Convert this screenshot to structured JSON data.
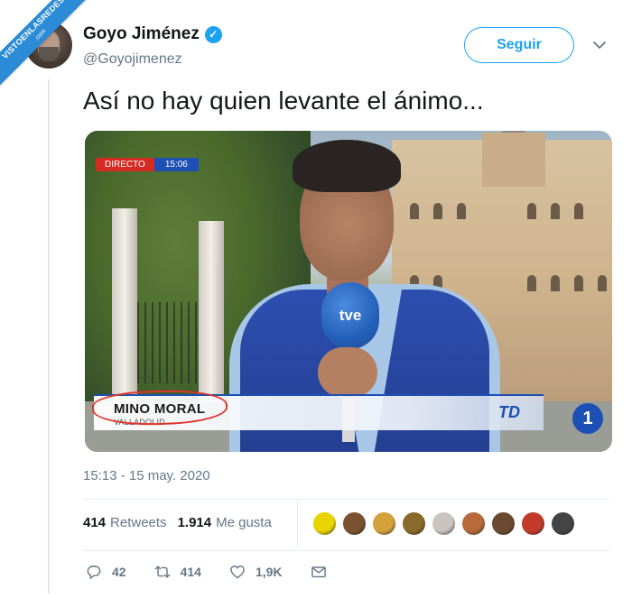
{
  "watermark": {
    "line1": "VISTOENLASREDES",
    "line2": ".com"
  },
  "author": {
    "display_name": "Goyo Jiménez",
    "handle": "@Goyojimenez",
    "verified_icon": "✓"
  },
  "follow_label": "Seguir",
  "tweet_text": "Así no hay quien levante el ánimo...",
  "media": {
    "live_label": "DIRECTO",
    "clock": "15:06",
    "mic_logo": "tve",
    "caption_name": "MINO MORAL",
    "caption_place": "VALLADOLID",
    "program_logo": "TD",
    "channel": "1",
    "annotation_color": "#e0332a"
  },
  "timestamp": "15:13 - 15 may. 2020",
  "stats": {
    "retweets_count": "414",
    "retweets_label": "Retweets",
    "likes_count": "1.914",
    "likes_label": "Me gusta"
  },
  "likers_colors": [
    "#e8d400",
    "#7a5230",
    "#d4a13a",
    "#8a6a2a",
    "#c9c4bf",
    "#b86a3a",
    "#6a4a30",
    "#c23a2a",
    "#444444"
  ],
  "actions": {
    "replies": "42",
    "retweets": "414",
    "likes": "1,9K"
  },
  "colors": {
    "accent": "#1da1f2",
    "muted": "#657786",
    "text": "#14171a"
  }
}
